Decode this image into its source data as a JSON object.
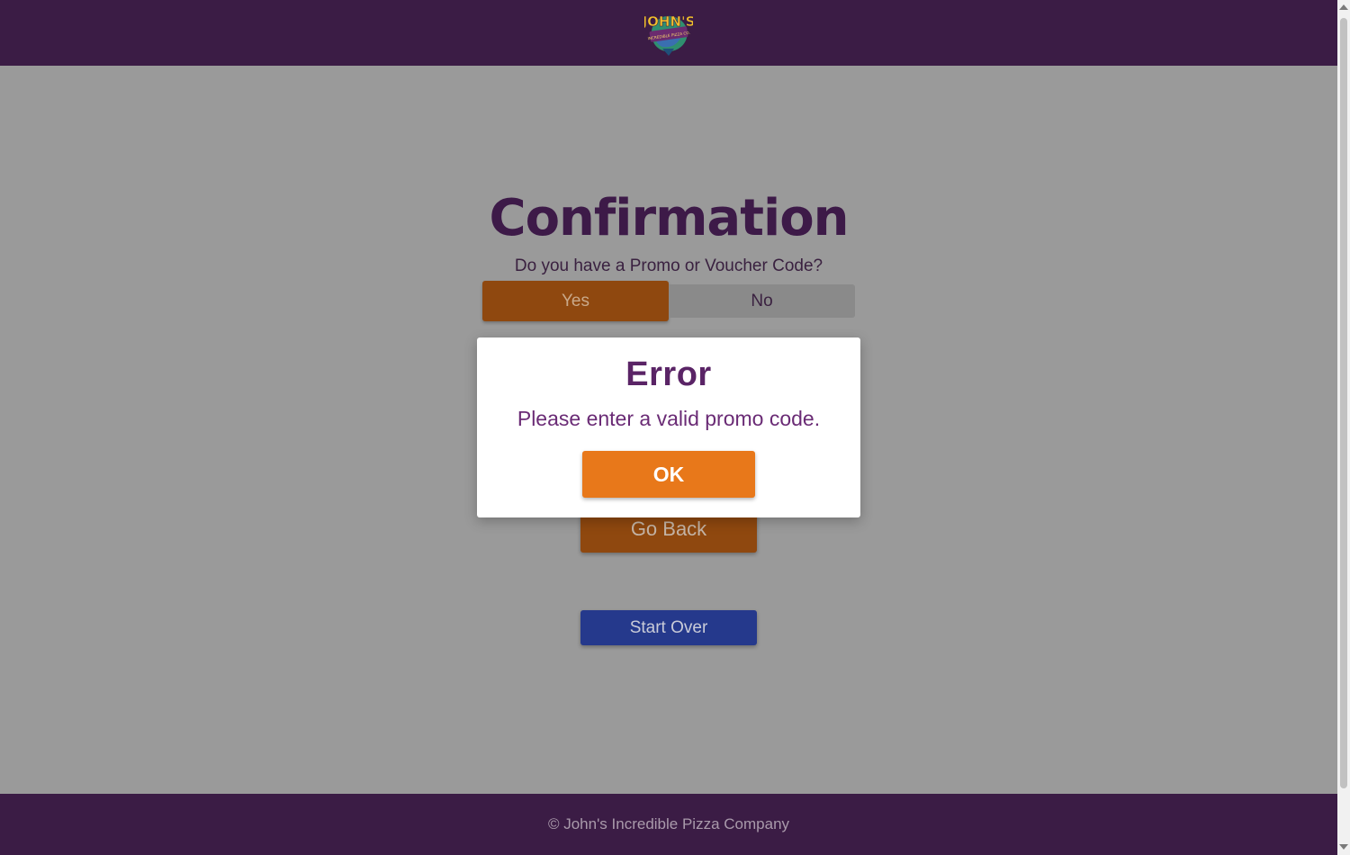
{
  "header": {
    "logo_text_top": "JOHN'S",
    "logo_text_sub": "INCREDIBLE PIZZA CO."
  },
  "main": {
    "title": "Confirmation",
    "question": "Do you have a Promo or Voucher Code?",
    "toggle": {
      "yes_label": "Yes",
      "no_label": "No",
      "selected": "Yes"
    },
    "go_back_label": "Go Back",
    "start_over_label": "Start Over"
  },
  "modal": {
    "title": "Error",
    "message": "Please enter a valid promo code.",
    "ok_label": "OK"
  },
  "footer": {
    "copyright": "© John's Incredible Pizza Company"
  },
  "colors": {
    "header_bg": "#3b1c45",
    "accent_orange": "#e8781a",
    "start_over_blue": "#25398c",
    "title_purple": "#3d1a48"
  }
}
